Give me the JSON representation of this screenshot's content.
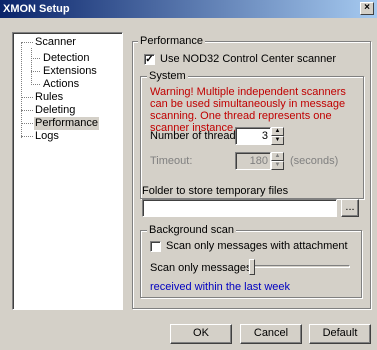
{
  "window": {
    "title": "XMON Setup",
    "close_glyph": "×"
  },
  "tree": {
    "items": [
      {
        "label": "Scanner"
      },
      {
        "label": "Detection"
      },
      {
        "label": "Extensions"
      },
      {
        "label": "Actions"
      },
      {
        "label": "Rules"
      },
      {
        "label": "Deleting"
      },
      {
        "label": "Performance",
        "selected": true
      },
      {
        "label": "Logs"
      }
    ]
  },
  "performance": {
    "group_label": "Performance",
    "use_nod32": {
      "label": "Use NOD32 Control Center scanner",
      "checked": true,
      "mark": "✓"
    },
    "system": {
      "label": "System",
      "warning": "Warning! Multiple independent scanners can be used simultaneously in message scanning. One thread represents one scanner instance.",
      "threads": {
        "label": "Number of threads:",
        "value": "3"
      },
      "timeout": {
        "label": "Timeout:",
        "value": "180",
        "unit": "(seconds)"
      }
    },
    "folder": {
      "label": "Folder to store temporary files",
      "value": "",
      "browse": "..."
    },
    "background": {
      "label": "Background scan",
      "attachment": {
        "label": "Scan only messages with attachment",
        "checked": false
      },
      "messages": {
        "label": "Scan only messages:",
        "slider_level": 0
      },
      "period": "received within the last week"
    }
  },
  "buttons": {
    "ok": "OK",
    "cancel": "Cancel",
    "default": "Default"
  }
}
